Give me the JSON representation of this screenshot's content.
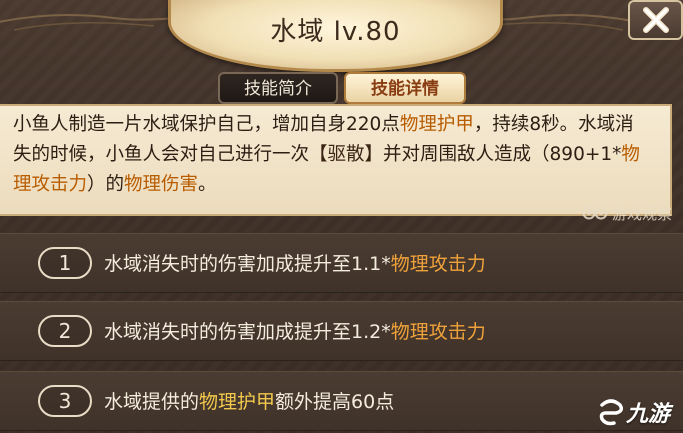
{
  "window": {
    "title": "水域 lv.80",
    "close_icon": "close-x-icon"
  },
  "tabs": [
    {
      "label": "技能简介",
      "active": false
    },
    {
      "label": "技能详情",
      "active": true
    }
  ],
  "description": {
    "part1": "小鱼人制造一片水域保护自己，增加自身220点",
    "hl1": "物理护甲",
    "part2": "，持续8秒。水域消失的时候，小鱼人会对自己进行一次",
    "hl2": "【驱散】",
    "part3": "并对周围敌人造成（890+1*",
    "hl3": "物理攻击力",
    "part4": "）的",
    "hl4": "物理伤害",
    "part5": "。"
  },
  "upgrades": [
    {
      "number": "1",
      "text": "水域消失时的伤害加成提升至1.1*",
      "highlight": "物理攻击力",
      "suffix": ""
    },
    {
      "number": "2",
      "text": "水域消失时的伤害加成提升至1.2*",
      "highlight": "物理攻击力",
      "suffix": ""
    },
    {
      "number": "3",
      "text": "水域提供的",
      "highlight": "物理护甲",
      "suffix": "额外提高60点"
    }
  ],
  "watermarks": {
    "site_label": "游戏观察",
    "logo_label": "九游"
  },
  "colors": {
    "highlight_orange": "#b85c00",
    "row_highlight": "#f0a23a",
    "accent_gold": "#b48a4c"
  }
}
